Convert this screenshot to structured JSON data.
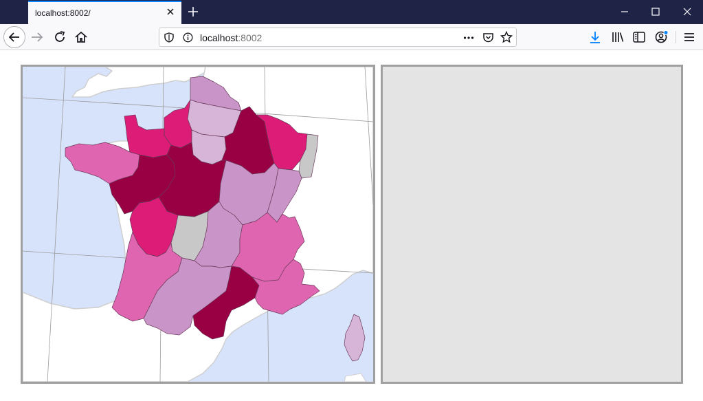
{
  "browser": {
    "tab_title": "localhost:8002/",
    "url_host": "localhost",
    "url_port": ":8002"
  },
  "colors": {
    "titlebar": "#1f2346",
    "sea": "#d6e3fb",
    "border_land": "#d0d0d0",
    "choropleth": [
      "#d7b5d8",
      "#c994c7",
      "#df65b0",
      "#dd1c77",
      "#980043"
    ],
    "no_data": "#c8c8c8"
  },
  "map": {
    "regions": [
      {
        "name": "hauts-de-france",
        "class": 1
      },
      {
        "name": "normandie-upper",
        "class": 3
      },
      {
        "name": "normandie-lower",
        "class": 3
      },
      {
        "name": "bretagne",
        "class": 2
      },
      {
        "name": "ile-de-france",
        "class": 0
      },
      {
        "name": "champagne",
        "class": 4
      },
      {
        "name": "lorraine",
        "class": 3
      },
      {
        "name": "alsace",
        "class": -1
      },
      {
        "name": "pays-de-la-loire",
        "class": 4
      },
      {
        "name": "centre",
        "class": 4
      },
      {
        "name": "bourgogne",
        "class": 1
      },
      {
        "name": "franche-comte",
        "class": 1
      },
      {
        "name": "poitou-charentes",
        "class": 3
      },
      {
        "name": "limousin",
        "class": -1
      },
      {
        "name": "auvergne",
        "class": 1
      },
      {
        "name": "rhone-alpes",
        "class": 2
      },
      {
        "name": "aquitaine",
        "class": 2
      },
      {
        "name": "midi-pyrenees",
        "class": 1
      },
      {
        "name": "languedoc",
        "class": 4
      },
      {
        "name": "paca",
        "class": 2
      },
      {
        "name": "corse",
        "class": 0
      },
      {
        "name": "picardie",
        "class": 0
      }
    ]
  }
}
